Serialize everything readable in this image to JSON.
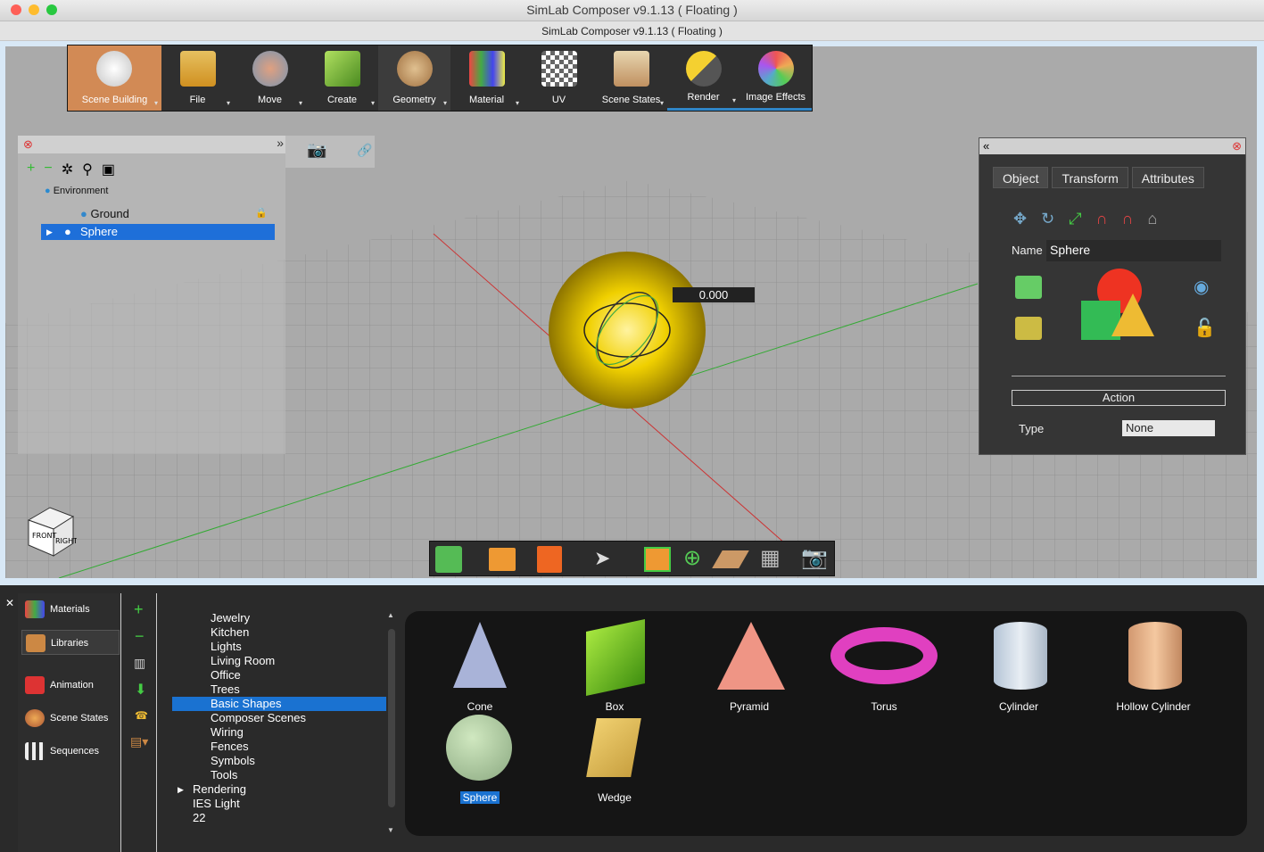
{
  "window": {
    "title": "SimLab Composer v9.1.13 ( Floating )",
    "subtitle": "SimLab Composer v9.1.13 ( Floating )"
  },
  "toolbar": {
    "items": [
      {
        "label": "Scene Building",
        "icon": "scene-building-icon"
      },
      {
        "label": "File",
        "icon": "file-icon"
      },
      {
        "label": "Move",
        "icon": "move-icon"
      },
      {
        "label": "Create",
        "icon": "create-icon"
      },
      {
        "label": "Geometry",
        "icon": "geometry-icon"
      },
      {
        "label": "Material",
        "icon": "material-icon"
      },
      {
        "label": "UV",
        "icon": "uv-icon"
      },
      {
        "label": "Scene States",
        "icon": "scene-states-icon"
      },
      {
        "label": "Render",
        "icon": "render-icon"
      },
      {
        "label": "Image Effects",
        "icon": "image-effects-icon"
      }
    ]
  },
  "scene_tree": {
    "environment": "Environment",
    "items": [
      "Ground",
      "Sphere"
    ],
    "selected": "Sphere"
  },
  "viewport": {
    "value_readout": "0.000"
  },
  "properties": {
    "tabs": [
      "Object",
      "Transform",
      "Attributes"
    ],
    "active_tab": "Object",
    "name_label": "Name",
    "name_value": "Sphere",
    "action_header": "Action",
    "type_label": "Type",
    "type_value": "None"
  },
  "left_nav": {
    "items": [
      "Materials",
      "Libraries",
      "Animation",
      "Scene States",
      "Sequences"
    ],
    "selected": "Libraries"
  },
  "library_categories": {
    "items": [
      "Jewelry",
      "Kitchen",
      "Lights",
      "Living Room",
      "Office",
      "Trees",
      "Basic Shapes",
      "Composer Scenes",
      "Wiring",
      "Fences",
      "Symbols",
      "Tools",
      "Rendering",
      "IES Light",
      "22"
    ],
    "selected": "Basic Shapes"
  },
  "gallery": {
    "items": [
      "Cone",
      "Box",
      "Pyramid",
      "Torus",
      "Cylinder",
      "Hollow Cylinder",
      "Sphere",
      "Wedge"
    ],
    "selected": "Sphere"
  },
  "colors": {
    "accent": "#1a72d1",
    "toolbar_active": "#d28a55",
    "sphere": "#e8c400"
  }
}
